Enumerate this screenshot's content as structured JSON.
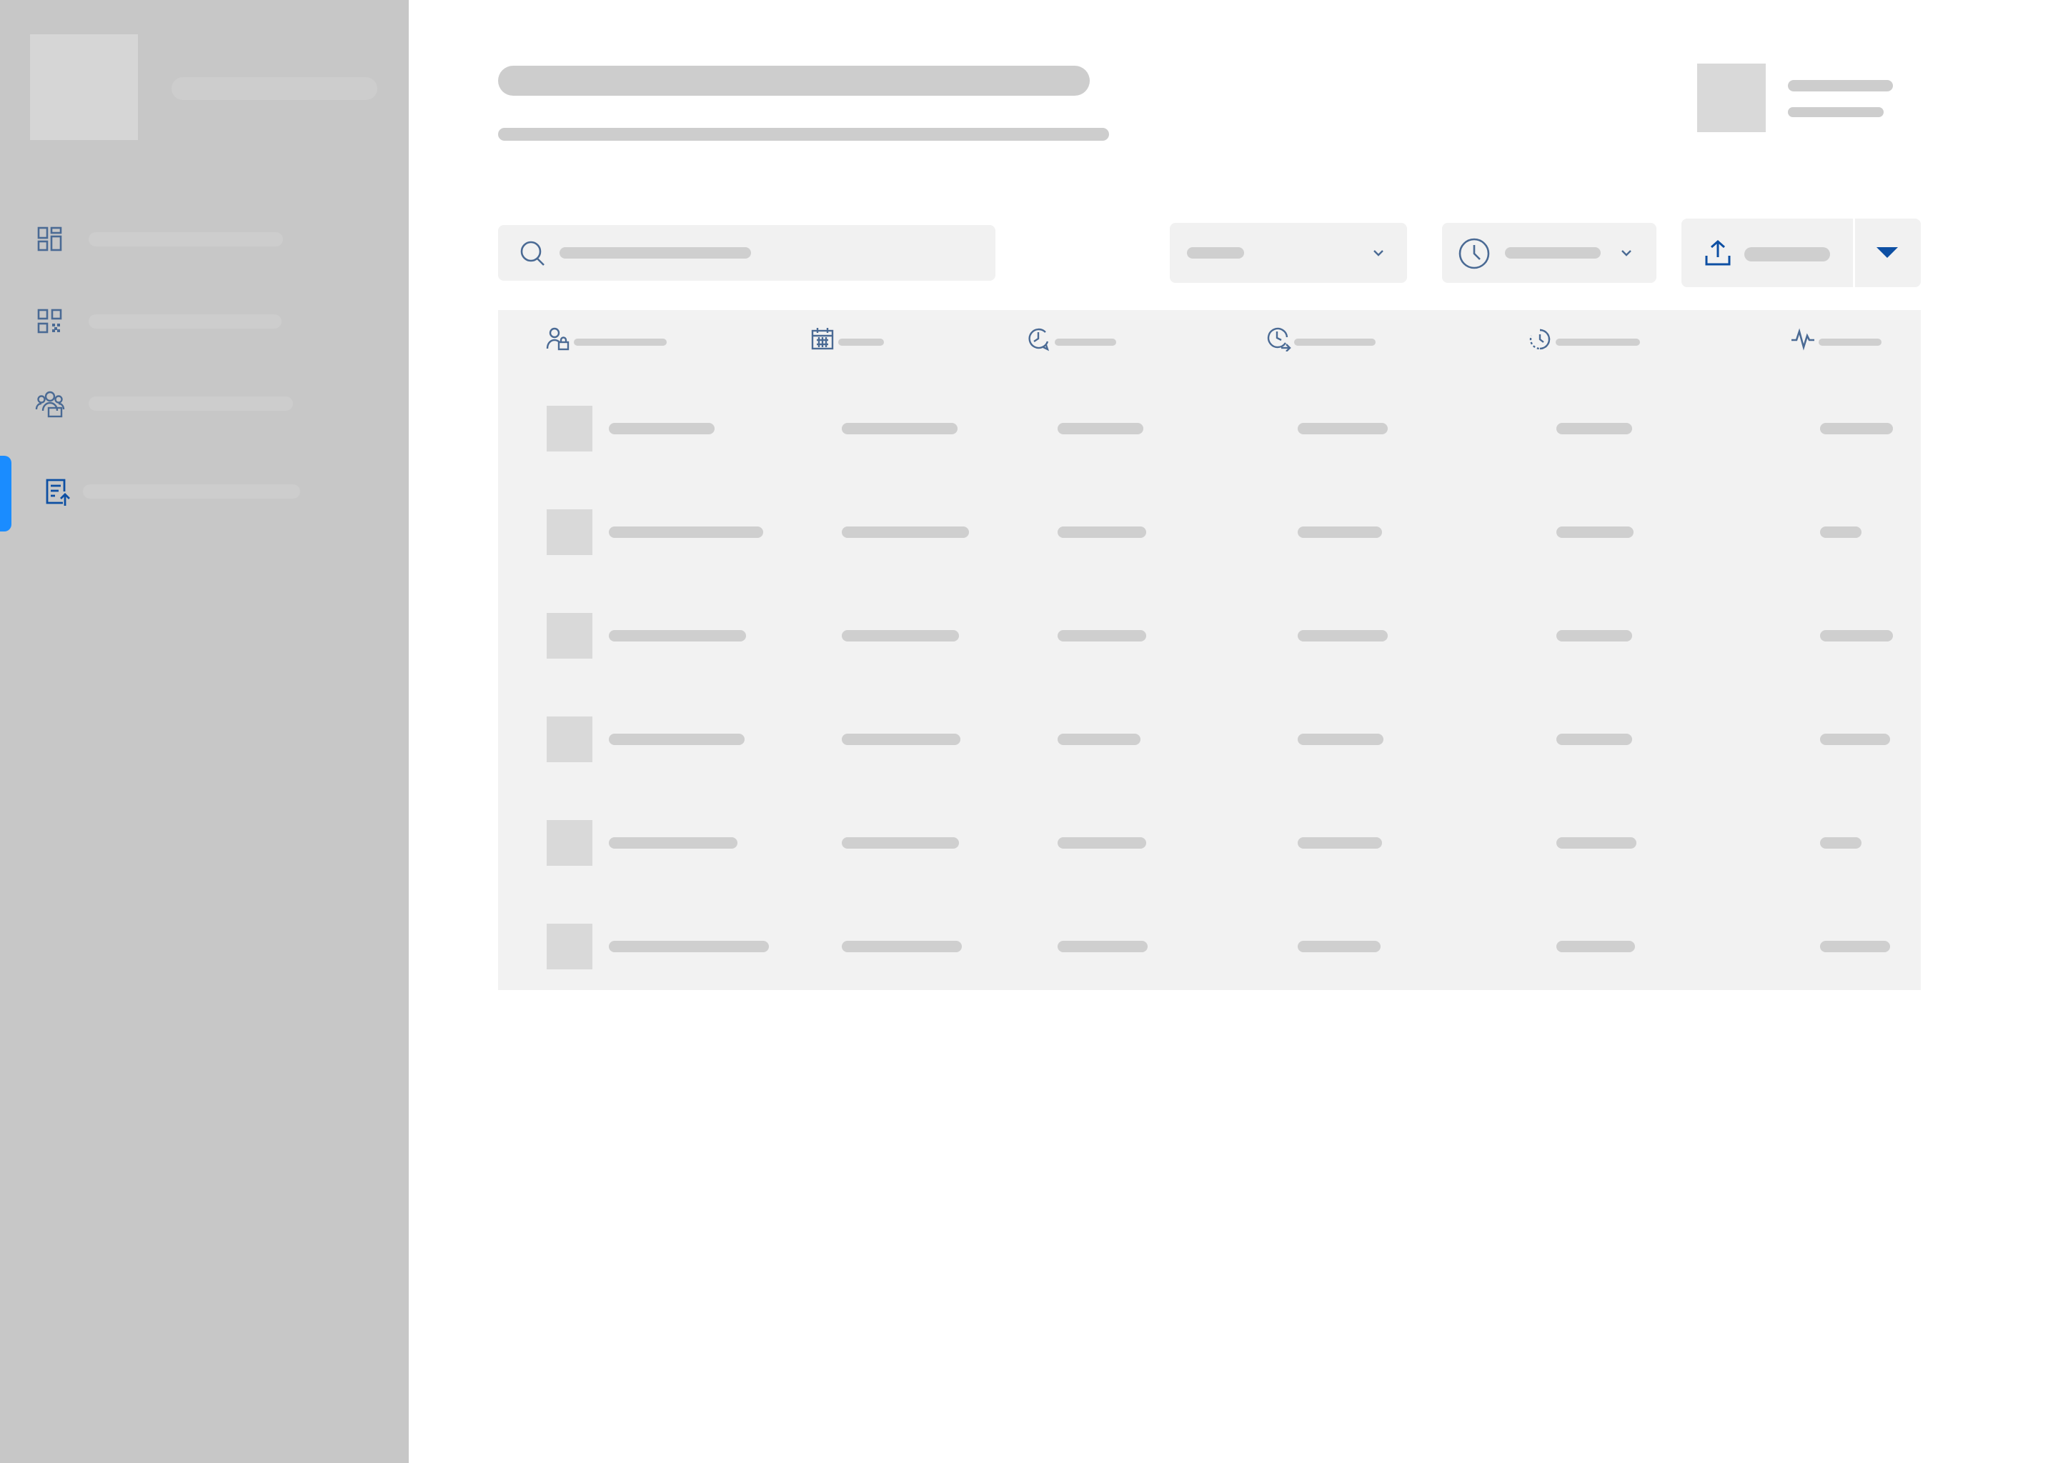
{
  "theme": {
    "sidebar_bg": "#c7c7c7",
    "accent": "#1a8cff",
    "icon_color": "#4a6a94",
    "active_icon_color": "#0d4fa3",
    "skeleton": "#cfcfcf",
    "surface": "#f2f2f2"
  },
  "sidebar": {
    "logo": "logo-placeholder",
    "items": [
      {
        "icon": "dashboard-icon",
        "active": false
      },
      {
        "icon": "qr-code-icon",
        "active": false
      },
      {
        "icon": "team-icon",
        "active": false
      },
      {
        "icon": "upload-document-icon",
        "active": true
      }
    ]
  },
  "header": {
    "user_avatar": "avatar-placeholder"
  },
  "toolbar": {
    "search_icon": "search-icon",
    "filter_icon": "chevron-down-icon",
    "time_icon": "clock-icon",
    "export_icon": "upload-icon",
    "export_menu_icon": "caret-down-icon"
  },
  "table": {
    "columns": [
      {
        "icon": "user-lock-icon"
      },
      {
        "icon": "calendar-icon"
      },
      {
        "icon": "clock-history-icon"
      },
      {
        "icon": "clock-forward-icon"
      },
      {
        "icon": "timer-icon"
      },
      {
        "icon": "activity-icon"
      }
    ],
    "row_count": 6
  }
}
